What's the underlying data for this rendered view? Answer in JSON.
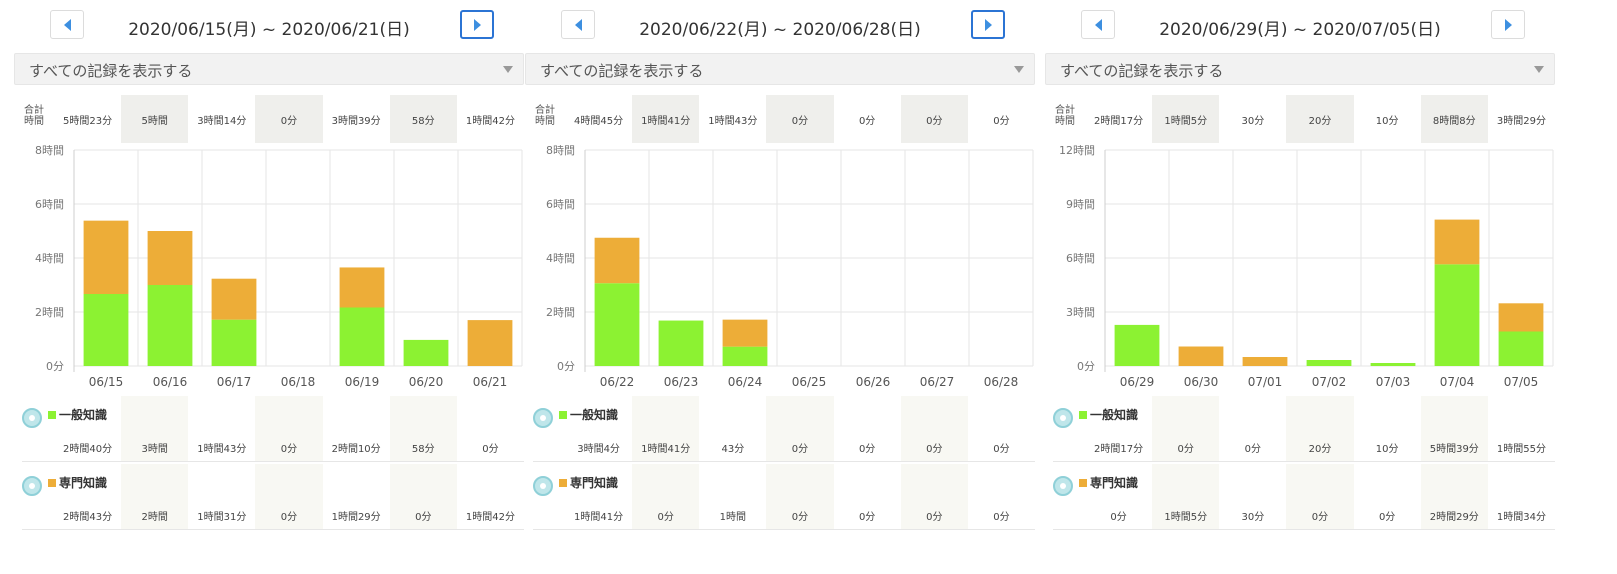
{
  "colors": {
    "general": "#8cf232",
    "special": "#edad38",
    "accent": "#3d8fe0",
    "grid": "#e5e5e5"
  },
  "icons": {
    "prev": "chevron-left-icon",
    "next": "chevron-right-icon",
    "filter": "chevron-down-icon"
  },
  "labels": {
    "filter": "すべての記録を表示する",
    "total_label_line1": "合計",
    "total_label_line2": "時間",
    "category_general": "一般知識",
    "category_special": "専門知識"
  },
  "weeks": [
    {
      "title": "2020/06/15(月) ~ 2020/06/21(日)",
      "next_active": true,
      "totals": [
        "5時間23分",
        "5時間",
        "3時間14分",
        "0分",
        "3時間39分",
        "58分",
        "1時間42分"
      ],
      "general": [
        "2時間40分",
        "3時間",
        "1時間43分",
        "0分",
        "2時間10分",
        "58分",
        "0分"
      ],
      "special": [
        "2時間43分",
        "2時間",
        "1時間31分",
        "0分",
        "1時間29分",
        "0分",
        "1時間42分"
      ],
      "yticks": [
        "0分",
        "2時間",
        "4時間",
        "6時間",
        "8時間"
      ]
    },
    {
      "title": "2020/06/22(月) ~ 2020/06/28(日)",
      "next_active": true,
      "totals": [
        "4時間45分",
        "1時間41分",
        "1時間43分",
        "0分",
        "0分",
        "0分",
        "0分"
      ],
      "general": [
        "3時間4分",
        "1時間41分",
        "43分",
        "0分",
        "0分",
        "0分",
        "0分"
      ],
      "special": [
        "1時間41分",
        "0分",
        "1時間",
        "0分",
        "0分",
        "0分",
        "0分"
      ],
      "yticks": [
        "0分",
        "2時間",
        "4時間",
        "6時間",
        "8時間"
      ]
    },
    {
      "title": "2020/06/29(月) ~ 2020/07/05(日)",
      "next_active": false,
      "totals": [
        "2時間17分",
        "1時間5分",
        "30分",
        "20分",
        "10分",
        "8時間8分",
        "3時間29分"
      ],
      "general": [
        "2時間17分",
        "0分",
        "0分",
        "20分",
        "10分",
        "5時間39分",
        "1時間55分"
      ],
      "special": [
        "0分",
        "1時間5分",
        "30分",
        "0分",
        "0分",
        "2時間29分",
        "1時間34分"
      ],
      "yticks": [
        "0分",
        "3時間",
        "6時間",
        "9時間",
        "12時間"
      ]
    }
  ],
  "chart_data": [
    {
      "type": "bar",
      "stacked": true,
      "title": "2020/06/15(月) ~ 2020/06/21(日)",
      "categories": [
        "06/15",
        "06/16",
        "06/17",
        "06/18",
        "06/19",
        "06/20",
        "06/21"
      ],
      "series": [
        {
          "name": "一般知識",
          "values": [
            160,
            180,
            103,
            0,
            130,
            58,
            0
          ]
        },
        {
          "name": "専門知識",
          "values": [
            163,
            120,
            91,
            0,
            89,
            0,
            102
          ]
        }
      ],
      "ylim": [
        0,
        480
      ],
      "grid": true
    },
    {
      "type": "bar",
      "stacked": true,
      "title": "2020/06/22(月) ~ 2020/06/28(日)",
      "categories": [
        "06/22",
        "06/23",
        "06/24",
        "06/25",
        "06/26",
        "06/27",
        "06/28"
      ],
      "series": [
        {
          "name": "一般知識",
          "values": [
            184,
            101,
            43,
            0,
            0,
            0,
            0
          ]
        },
        {
          "name": "専門知識",
          "values": [
            101,
            0,
            60,
            0,
            0,
            0,
            0
          ]
        }
      ],
      "ylim": [
        0,
        480
      ],
      "grid": true
    },
    {
      "type": "bar",
      "stacked": true,
      "title": "2020/06/29(月) ~ 2020/07/05(日)",
      "categories": [
        "06/29",
        "06/30",
        "07/01",
        "07/02",
        "07/03",
        "07/04",
        "07/05"
      ],
      "series": [
        {
          "name": "一般知識",
          "values": [
            137,
            0,
            0,
            20,
            10,
            339,
            115
          ]
        },
        {
          "name": "専門知識",
          "values": [
            0,
            65,
            30,
            0,
            0,
            149,
            94
          ]
        }
      ],
      "ylim": [
        0,
        720
      ],
      "grid": true
    }
  ]
}
